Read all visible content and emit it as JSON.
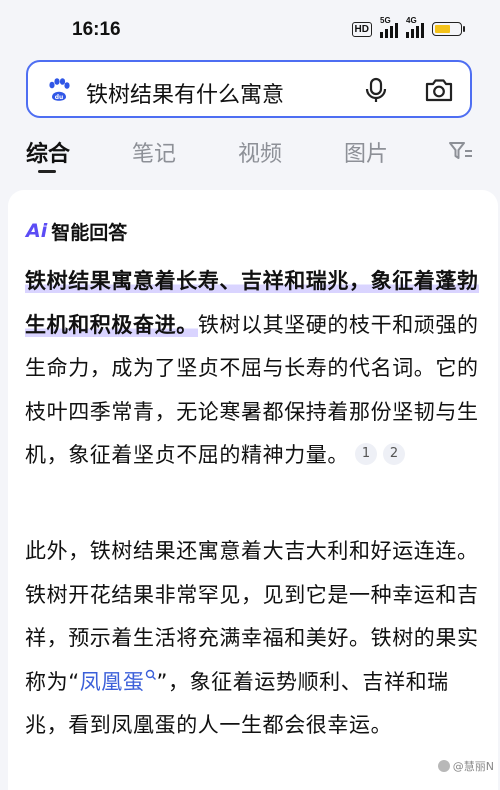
{
  "status_bar": {
    "time": "16:16",
    "hd_label": "HD",
    "signal_1_label": "5G",
    "signal_2_label": "4G",
    "battery_level": 0.65,
    "battery_color": "#f4c21a"
  },
  "search": {
    "query": "铁树结果有什么寓意",
    "icons": [
      "baidu-paw-icon",
      "mic-icon",
      "camera-icon"
    ]
  },
  "tabs": [
    {
      "label": "综合",
      "active": true
    },
    {
      "label": "笔记",
      "active": false
    },
    {
      "label": "视频",
      "active": false
    },
    {
      "label": "图片",
      "active": false
    }
  ],
  "ai_answer": {
    "logo_text": "Ai",
    "title": "智能回答",
    "paragraph1_highlight": "铁树结果寓意着长寿、吉祥和瑞兆，象征着蓬勃生机和积极奋进。",
    "paragraph1_rest": "铁树以其坚硬的枝干和顽强的生命力，成为了坚贞不屈与长寿的代名词。它的枝叶四季常青，无论寒暑都保持着那份坚韧与生机，象征着坚贞不屈的精神力量。",
    "citations": [
      "1",
      "2"
    ],
    "paragraph2_part1": "此外，铁树结果还寓意着大吉大利和好运连连。铁树开花结果非常罕见，见到它是一种幸运和吉祥，预示着生活将充满幸福和美好。铁树的果实称为“",
    "paragraph2_link": "凤凰蛋",
    "paragraph2_part2": "”，象征着运势顺利、吉祥和瑞兆，看到凤凰蛋的人一生都会很幸运。"
  },
  "watermark": "@慧丽N",
  "colors": {
    "accent": "#4e6ef2",
    "ai_purple": "#5b4cf5",
    "link": "#3b5fd9",
    "background": "#f4f5f9"
  }
}
